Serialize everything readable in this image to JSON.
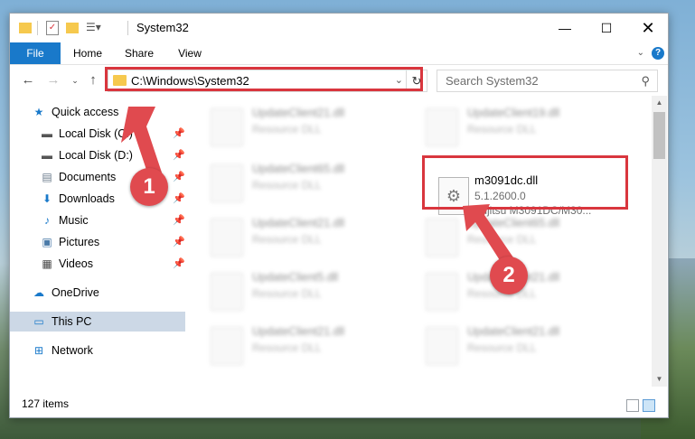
{
  "window": {
    "title": "System32"
  },
  "ribbon": {
    "tabs": [
      "File",
      "Home",
      "Share",
      "View"
    ],
    "help": "?"
  },
  "nav": {
    "address": "C:\\Windows\\System32",
    "search_placeholder": "Search System32"
  },
  "sidebar": {
    "items": [
      {
        "label": "Quick access",
        "icon": "star-icon"
      },
      {
        "label": "Local Disk (C:)",
        "icon": "drive-icon"
      },
      {
        "label": "Local Disk (D:)",
        "icon": "drive-icon"
      },
      {
        "label": "Documents",
        "icon": "documents-icon"
      },
      {
        "label": "Downloads",
        "icon": "download-icon"
      },
      {
        "label": "Music",
        "icon": "music-icon"
      },
      {
        "label": "Pictures",
        "icon": "pictures-icon"
      },
      {
        "label": "Videos",
        "icon": "videos-icon"
      },
      {
        "label": "OneDrive",
        "icon": "cloud-icon"
      },
      {
        "label": "This PC",
        "icon": "computer-icon"
      },
      {
        "label": "Network",
        "icon": "network-icon"
      }
    ]
  },
  "files": [
    {
      "name": "UpdateClient21.dll",
      "desc": "Resource DLL"
    },
    {
      "name": "UpdateClient19.dll",
      "desc": "Resource DLL"
    },
    {
      "name": "UpdateClient65.dll",
      "desc": "Resource DLL"
    },
    {
      "name": "UpdateClient21.dll",
      "desc": "Resource DLL"
    },
    {
      "name": "UpdateClient65.dll",
      "desc": "Resource DLL"
    },
    {
      "name": "UpdateClient5.dll",
      "desc": "Resource DLL"
    },
    {
      "name": "UpdateClient21.dll",
      "desc": "Resource DLL"
    },
    {
      "name": "UpdateClient21.dll",
      "desc": "Resource DLL"
    },
    {
      "name": "UpdateClient21.dll",
      "desc": "Resource DLL"
    }
  ],
  "highlighted_file": {
    "name": "m3091dc.dll",
    "version": "5.1.2600.0",
    "description": "Fujitsu M3091DC/M30..."
  },
  "status": {
    "item_count": "127 items"
  },
  "callouts": [
    "1",
    "2"
  ],
  "colors": {
    "accent": "#1979ca",
    "highlight": "#d9363e",
    "callout": "#e04a4f"
  }
}
